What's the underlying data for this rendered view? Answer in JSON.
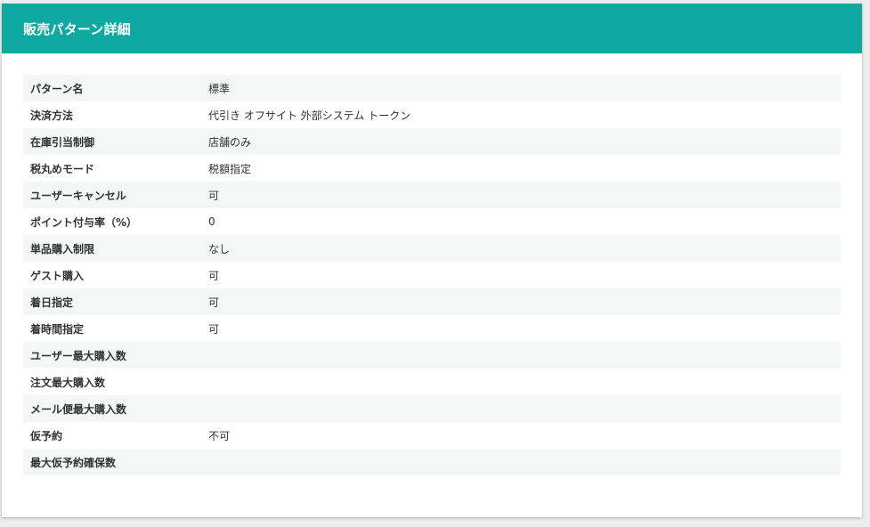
{
  "panel": {
    "title": "販売パターン詳細"
  },
  "rows": [
    {
      "label": "パターン名",
      "value": "標準"
    },
    {
      "label": "決済方法",
      "value": "代引き オフサイト 外部システム トークン"
    },
    {
      "label": "在庫引当制御",
      "value": "店舗のみ"
    },
    {
      "label": "税丸めモード",
      "value": "税額指定"
    },
    {
      "label": "ユーザーキャンセル",
      "value": "可"
    },
    {
      "label": "ポイント付与率（%）",
      "value": "0"
    },
    {
      "label": "単品購入制限",
      "value": "なし"
    },
    {
      "label": "ゲスト購入",
      "value": "可"
    },
    {
      "label": "着日指定",
      "value": "可"
    },
    {
      "label": "着時間指定",
      "value": "可"
    },
    {
      "label": "ユーザー最大購入数",
      "value": ""
    },
    {
      "label": "注文最大購入数",
      "value": ""
    },
    {
      "label": "メール便最大購入数",
      "value": ""
    },
    {
      "label": "仮予約",
      "value": "不可"
    },
    {
      "label": "最大仮予約確保数",
      "value": ""
    }
  ]
}
